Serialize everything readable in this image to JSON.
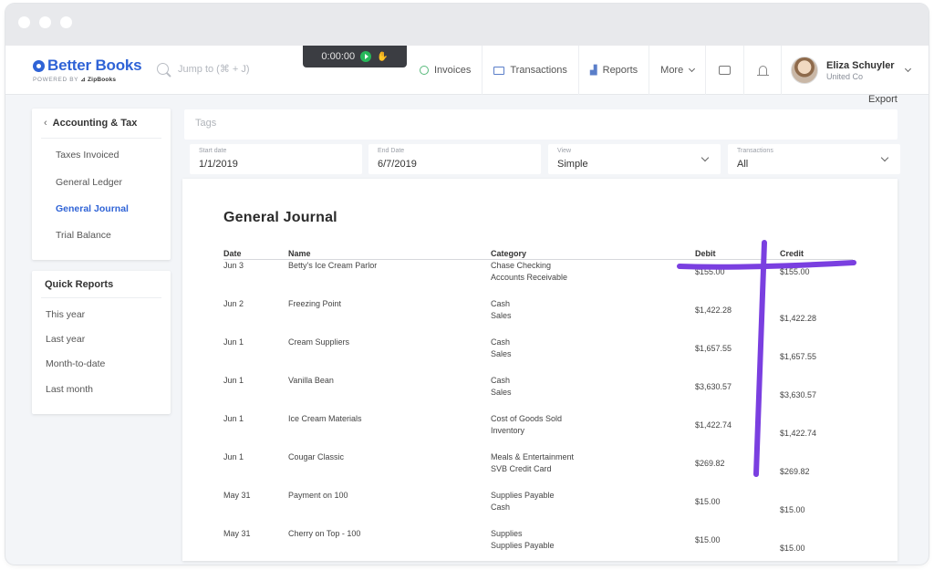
{
  "timer": {
    "time": "0:00:00"
  },
  "brand": {
    "name": "Better Books",
    "powered": "POWERED BY",
    "partner": "ZipBooks"
  },
  "search": {
    "placeholder": "Jump to (⌘ + J)"
  },
  "nav": {
    "invoices": "Invoices",
    "transactions": "Transactions",
    "reports": "Reports",
    "more": "More"
  },
  "user": {
    "name": "Eliza Schuyler",
    "org": "United Co"
  },
  "export_label": "Export",
  "sidebar": {
    "section_title": "Accounting & Tax",
    "items": [
      {
        "label": "Taxes Invoiced"
      },
      {
        "label": "General Ledger"
      },
      {
        "label": "General Journal",
        "active": true
      },
      {
        "label": "Trial Balance"
      }
    ],
    "quick_title": "Quick Reports",
    "quick_items": [
      {
        "label": "This year"
      },
      {
        "label": "Last year"
      },
      {
        "label": "Month-to-date"
      },
      {
        "label": "Last month"
      }
    ]
  },
  "filters": {
    "tags_placeholder": "Tags",
    "start": {
      "label": "Start date",
      "value": "1/1/2019"
    },
    "end": {
      "label": "End Date",
      "value": "6/7/2019"
    },
    "view": {
      "label": "View",
      "value": "Simple"
    },
    "transactions": {
      "label": "Transactions",
      "value": "All"
    }
  },
  "report": {
    "title": "General Journal",
    "columns": {
      "date": "Date",
      "name": "Name",
      "category": "Category",
      "debit": "Debit",
      "credit": "Credit"
    },
    "entries": [
      {
        "date": "Jun 3",
        "name": "Betty's Ice Cream Parlor",
        "cat1": "Chase Checking",
        "cat2": "Accounts Receivable",
        "debit": "$155.00",
        "credit": "$155.00"
      },
      {
        "date": "Jun 2",
        "name": "Freezing Point",
        "cat1": "Cash",
        "cat2": "Sales",
        "debit": "$1,422.28",
        "credit": "$1,422.28"
      },
      {
        "date": "Jun 1",
        "name": "Cream Suppliers",
        "cat1": "Cash",
        "cat2": "Sales",
        "debit": "$1,657.55",
        "credit": "$1,657.55"
      },
      {
        "date": "Jun 1",
        "name": "Vanilla Bean",
        "cat1": "Cash",
        "cat2": "Sales",
        "debit": "$3,630.57",
        "credit": "$3,630.57"
      },
      {
        "date": "Jun 1",
        "name": "Ice Cream Materials",
        "cat1": "Cost of Goods Sold",
        "cat2": "Inventory",
        "debit": "$1,422.74",
        "credit": "$1,422.74"
      },
      {
        "date": "Jun 1",
        "name": "Cougar Classic",
        "cat1": "Meals & Entertainment",
        "cat2": "SVB Credit Card",
        "debit": "$269.82",
        "credit": "$269.82"
      },
      {
        "date": "May 31",
        "name": "Payment on 100",
        "cat1": "Supplies Payable",
        "cat2": "Cash",
        "debit": "$15.00",
        "credit": "$15.00"
      },
      {
        "date": "May 31",
        "name": "Cherry on Top - 100",
        "cat1": "Supplies",
        "cat2": "Supplies Payable",
        "debit": "$15.00",
        "credit": "$15.00"
      }
    ]
  },
  "colors": {
    "brand": "#2f63d6",
    "annotation": "#7a3fe0",
    "timer_play": "#27b85a"
  }
}
